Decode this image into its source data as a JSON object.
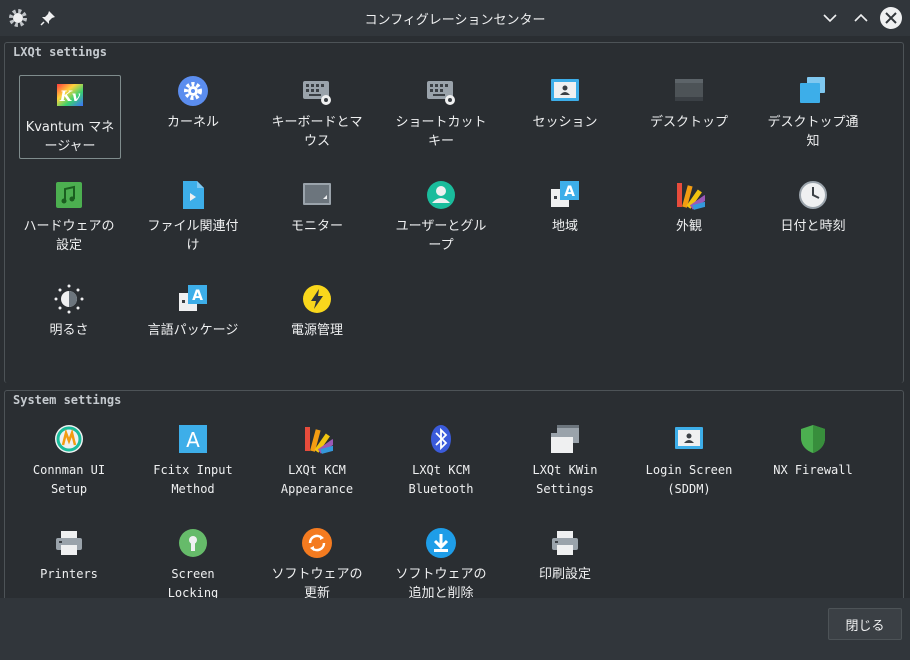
{
  "window": {
    "title": "コンフィグレーションセンター"
  },
  "sections": {
    "lxqt": {
      "title": "LXQt settings",
      "items": [
        {
          "label": "Kvantum マネージャー"
        },
        {
          "label": "カーネル"
        },
        {
          "label": "キーボードとマウス"
        },
        {
          "label": "ショートカットキー"
        },
        {
          "label": "セッション"
        },
        {
          "label": "デスクトップ"
        },
        {
          "label": "デスクトップ通知"
        },
        {
          "label": "ハードウェアの設定"
        },
        {
          "label": "ファイル関連付け"
        },
        {
          "label": "モニター"
        },
        {
          "label": "ユーザーとグループ"
        },
        {
          "label": "地域"
        },
        {
          "label": "外観"
        },
        {
          "label": "日付と時刻"
        },
        {
          "label": "明るさ"
        },
        {
          "label": "言語パッケージ"
        },
        {
          "label": "電源管理"
        }
      ]
    },
    "system": {
      "title": "System settings",
      "items": [
        {
          "label": "Connman UI Setup"
        },
        {
          "label": "Fcitx Input Method"
        },
        {
          "label": "LXQt KCM Appearance"
        },
        {
          "label": "LXQt KCM Bluetooth"
        },
        {
          "label": "LXQt KWin Settings"
        },
        {
          "label": "Login Screen (SDDM)"
        },
        {
          "label": "NX Firewall"
        },
        {
          "label": "Printers"
        },
        {
          "label": "Screen Locking"
        },
        {
          "label": "ソフトウェアの更新"
        },
        {
          "label": "ソフトウェアの追加と削除"
        },
        {
          "label": "印刷設定"
        }
      ]
    }
  },
  "footer": {
    "close_label": "閉じる"
  }
}
